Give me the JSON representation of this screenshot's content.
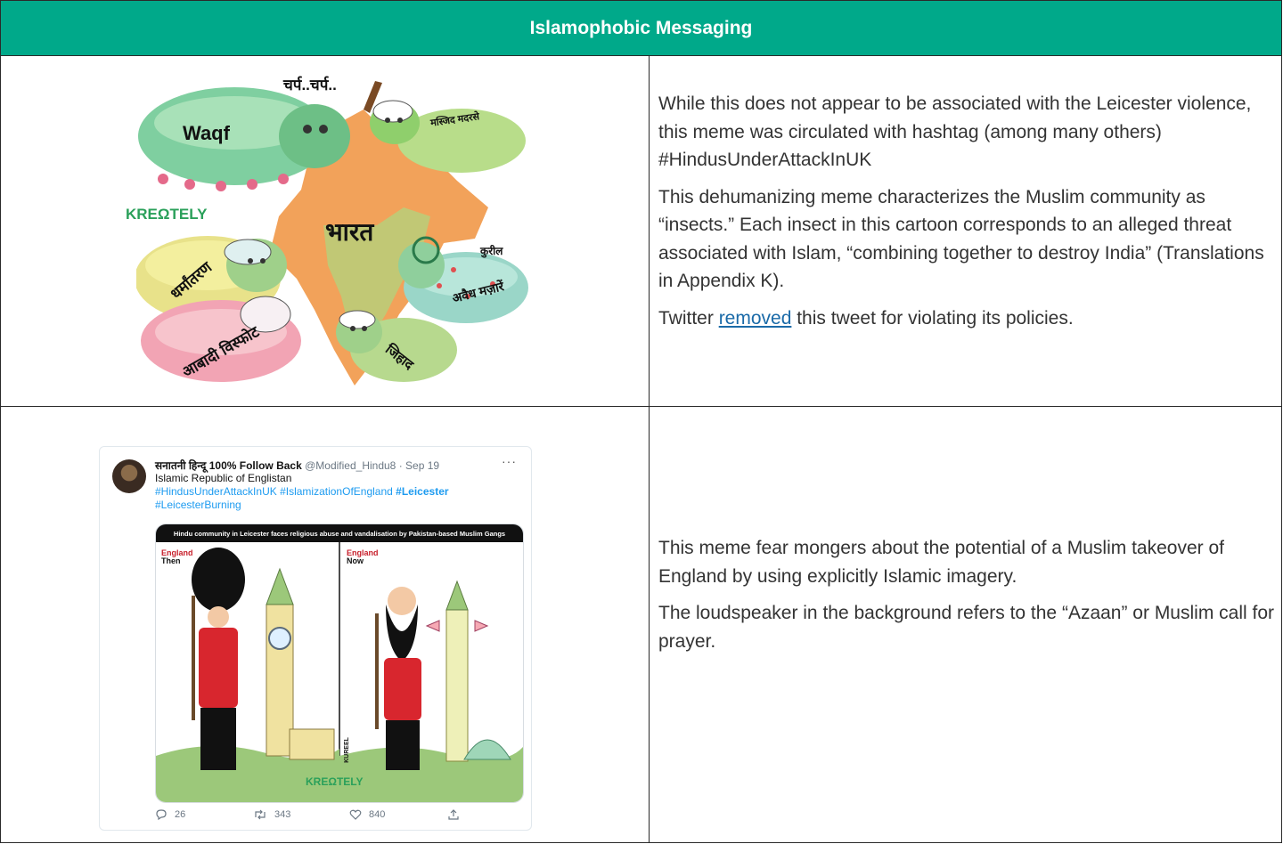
{
  "header": {
    "title": "Islamophobic Messaging"
  },
  "row1": {
    "paragraphs": [
      "While this does not appear to be associated with the Leicester violence, this meme was circulated with hashtag (among many others) #HindusUnderAttackInUK",
      "This dehumanizing meme characterizes the Muslim community as “insects.” Each insect in this cartoon corresponds to an alleged threat associated with Islam, “combining together to destroy India” (Translations in Appendix K)."
    ],
    "removed_prefix": "Twitter ",
    "removed_link": "removed",
    "removed_suffix": " this tweet for violating its policies.",
    "cartoon": {
      "labels": {
        "sound": "चर्प..चर्प..",
        "waqf": "Waqf",
        "masjid": "मस्जिद मदरसे",
        "brand": "KREΩTELY",
        "bharat": "भारत",
        "dharmantaran": "धर्मांतरण",
        "kureel": "कुरील",
        "avaidh": "अवैध मज़ारें",
        "abadi": "आबादी विस्फोट",
        "jihad": "जिहाद"
      }
    }
  },
  "row2": {
    "paragraphs": [
      "This meme fear mongers about the potential of a Muslim takeover of England by using explicitly Islamic imagery.",
      "The loudspeaker in the background refers to the “Azaan” or Muslim call for prayer."
    ],
    "tweet": {
      "name": "सनातनी हिन्दू 100% Follow Back",
      "handle": "@Modified_Hindu8",
      "date": "· Sep 19",
      "more": "···",
      "line1": "Islamic Republic of Englistan",
      "tag1": "#HindusUnderAttackInUK",
      "tag2": "#IslamizationOfEngland",
      "tag3": "#Leicester",
      "tag4": "#LeicesterBurning",
      "media_caption": "Hindu community in Leicester faces religious abuse and vandalisation by Pakistan-based Muslim Gangs",
      "left_label_a": "England",
      "left_label_b": "Then",
      "right_label_a": "England",
      "right_label_b": "Now",
      "brand": "KREΩTELY",
      "signature": "KUREEL",
      "replies": "26",
      "retweets": "343",
      "likes": "840"
    }
  },
  "colors": {
    "header_bg": "#00a98a",
    "link": "#1a6aa8",
    "tag": "#1d9bf0"
  }
}
